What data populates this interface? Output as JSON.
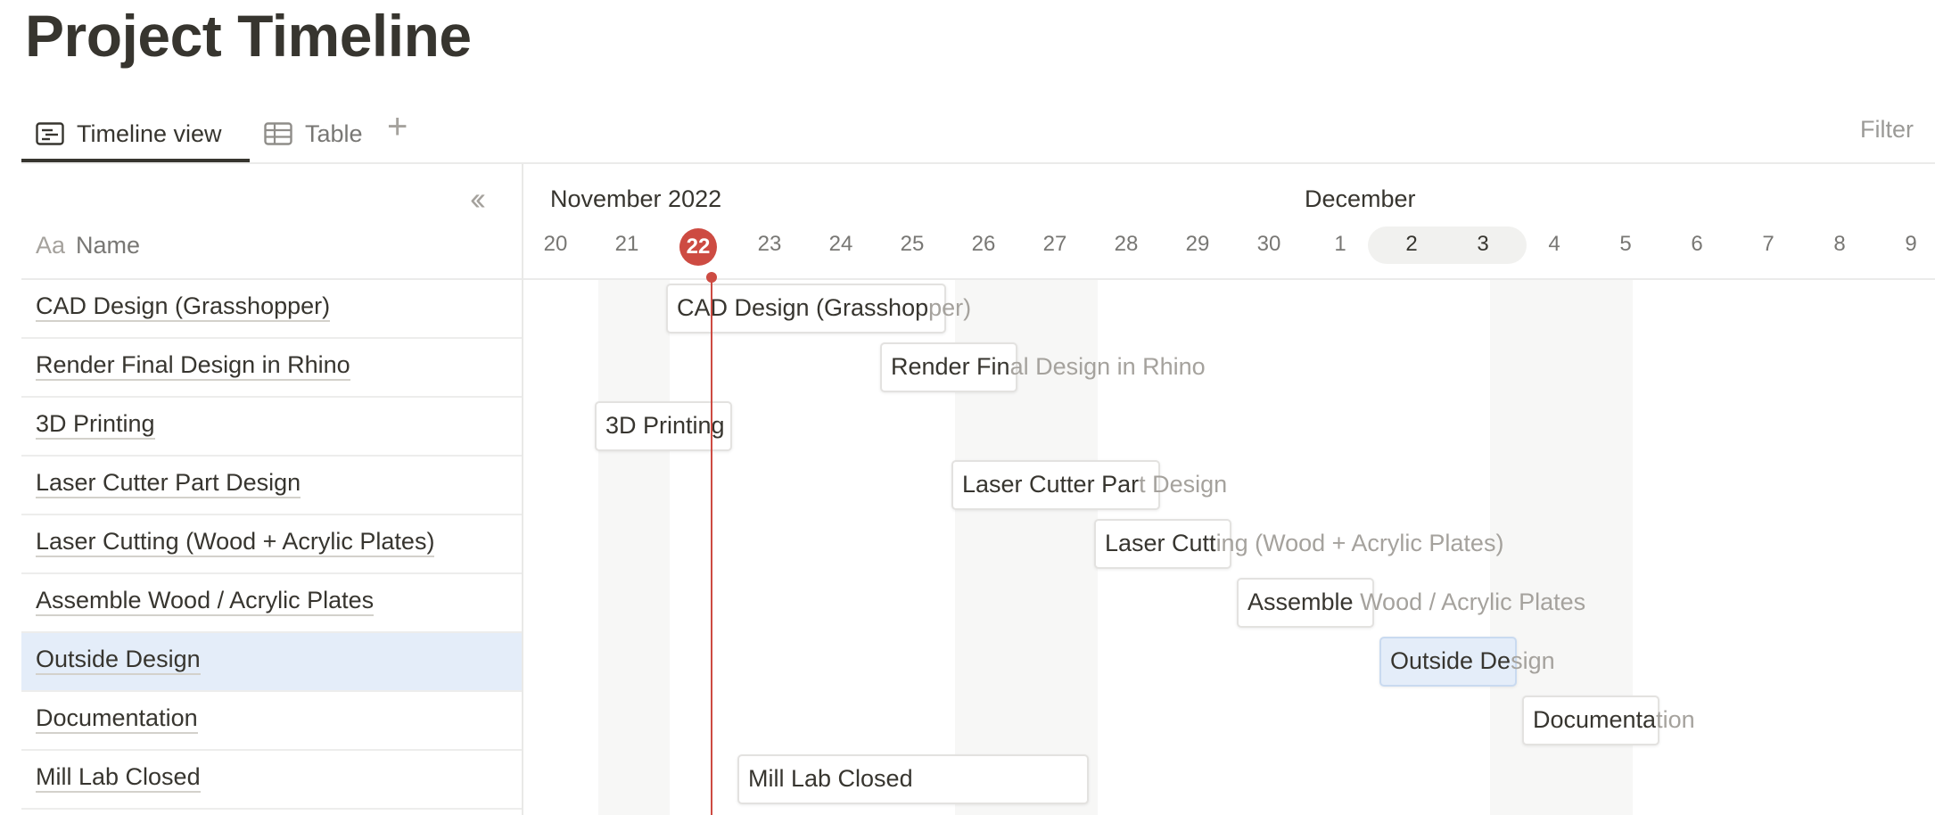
{
  "page": {
    "title": "Project Timeline"
  },
  "views": {
    "tabs": [
      {
        "label": "Timeline view",
        "icon": "timeline-icon",
        "active": true
      },
      {
        "label": "Table",
        "icon": "table-icon",
        "active": false
      }
    ],
    "add_icon": "plus-icon",
    "filter_label": "Filter"
  },
  "left_panel": {
    "collapse_icon": "double-chevron-left-icon",
    "name_header_prefix": "Aa",
    "name_header": "Name"
  },
  "timeline": {
    "months": [
      "November 2022",
      "December"
    ],
    "days": [
      "20",
      "21",
      "22",
      "23",
      "24",
      "25",
      "26",
      "27",
      "28",
      "29",
      "30",
      "1",
      "2",
      "3",
      "4",
      "5",
      "6",
      "7",
      "8",
      "9"
    ],
    "today": "22",
    "today_color": "#cd4b42"
  },
  "tasks": [
    {
      "name": "CAD Design (Grasshopper)",
      "bar_visible": "CAD Design (Grasshop",
      "bar_overflow": "per)"
    },
    {
      "name": "Render Final Design in Rhino",
      "bar_visible": "Render Fin",
      "bar_overflow": "al Design in Rhino"
    },
    {
      "name": "3D Printing",
      "bar_visible": "3D Printing",
      "bar_overflow": ""
    },
    {
      "name": "Laser Cutter Part Design",
      "bar_visible": "Laser Cutter Par",
      "bar_overflow": "t Design"
    },
    {
      "name": "Laser Cutting (Wood + Acrylic Plates)",
      "bar_visible": "Laser Cutt",
      "bar_overflow": "ing (Wood + Acrylic Plates)"
    },
    {
      "name": "Assemble Wood / Acrylic Plates",
      "bar_visible": "Assemble ",
      "bar_overflow": "Wood / Acrylic Plates"
    },
    {
      "name": "Outside Design",
      "bar_visible": "Outside De",
      "bar_overflow": "sign",
      "selected": true
    },
    {
      "name": "Documentation",
      "bar_visible": "Documenta",
      "bar_overflow": "tion"
    },
    {
      "name": "Mill Lab Closed",
      "bar_visible": "Mill Lab Closed",
      "bar_overflow": ""
    }
  ]
}
